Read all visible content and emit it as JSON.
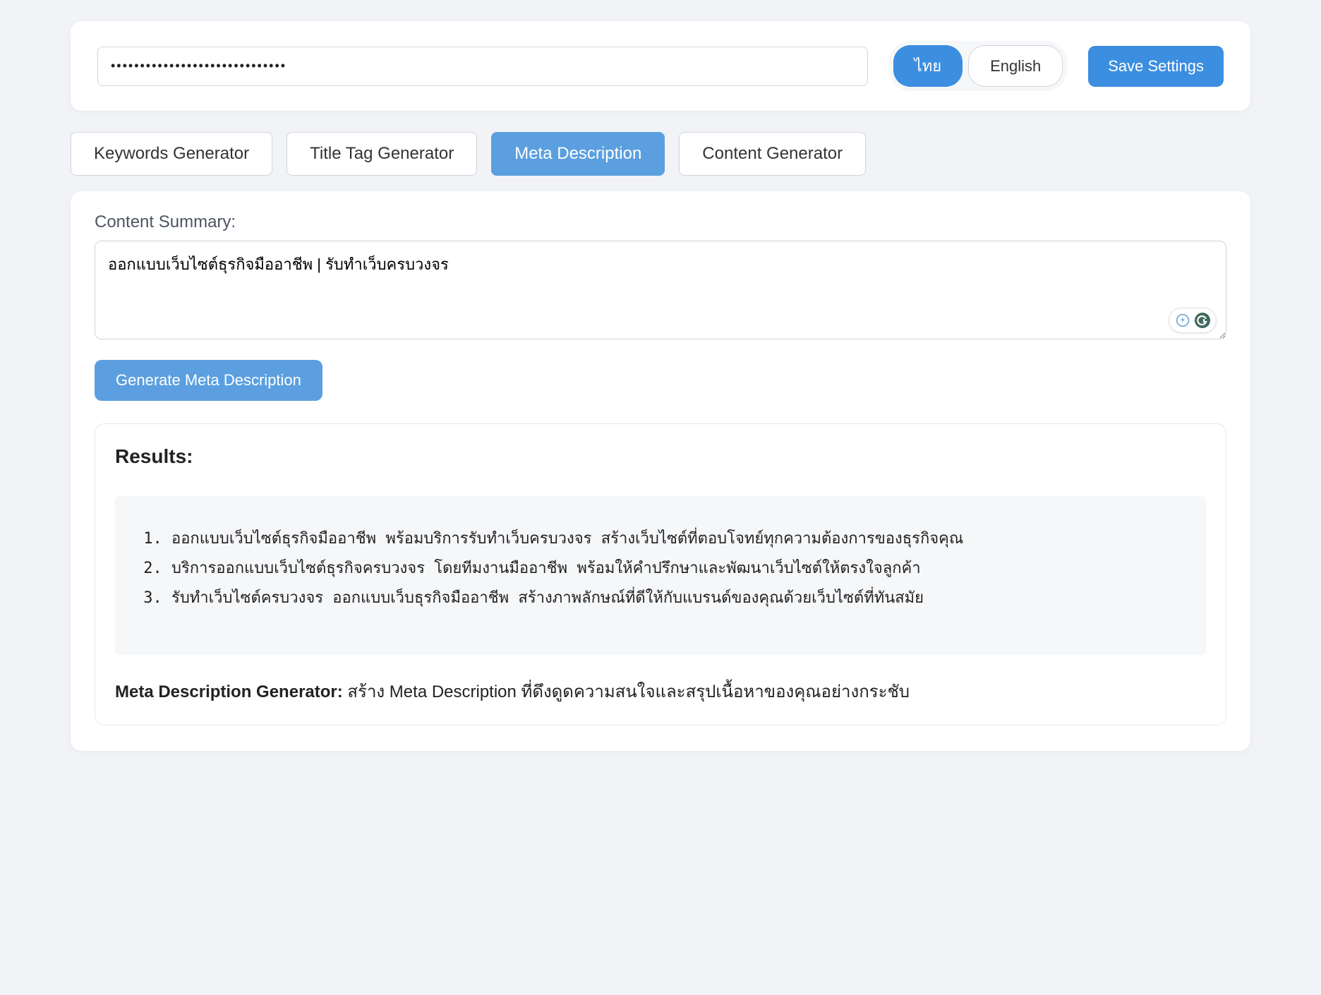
{
  "header": {
    "api_key_value": "••••••••••••••••••••••••••••••",
    "lang_thai": "ไทย",
    "lang_english": "English",
    "save_label": "Save Settings"
  },
  "tabs": {
    "keywords": "Keywords Generator",
    "title_tag": "Title Tag Generator",
    "meta_desc": "Meta Description",
    "content_gen": "Content Generator"
  },
  "main": {
    "summary_label": "Content Summary:",
    "summary_value": "ออกแบบเว็บไซต์ธุรกิจมืออาชีพ | รับทำเว็บครบวงจร",
    "generate_label": "Generate Meta Description"
  },
  "results": {
    "title": "Results:",
    "items": [
      "ออกแบบเว็บไซต์ธุรกิจมืออาชีพ พร้อมบริการรับทำเว็บครบวงจร สร้างเว็บไซต์ที่ตอบโจทย์ทุกความต้องการของธุรกิจคุณ",
      "บริการออกแบบเว็บไซต์ธุรกิจครบวงจร โดยทีมงานมืออาชีพ พร้อมให้คำปรึกษาและพัฒนาเว็บไซต์ให้ตรงใจลูกค้า",
      "รับทำเว็บไซต์ครบวงจร ออกแบบเว็บธุรกิจมืออาชีพ สร้างภาพลักษณ์ที่ดีให้กับแบรนด์ของคุณด้วยเว็บไซต์ที่ทันสมัย"
    ],
    "footer_bold": "Meta Description Generator:",
    "footer_rest": " สร้าง Meta Description ที่ดึงดูดความสนใจและสรุปเนื้อหาของคุณอย่างกระชับ"
  }
}
